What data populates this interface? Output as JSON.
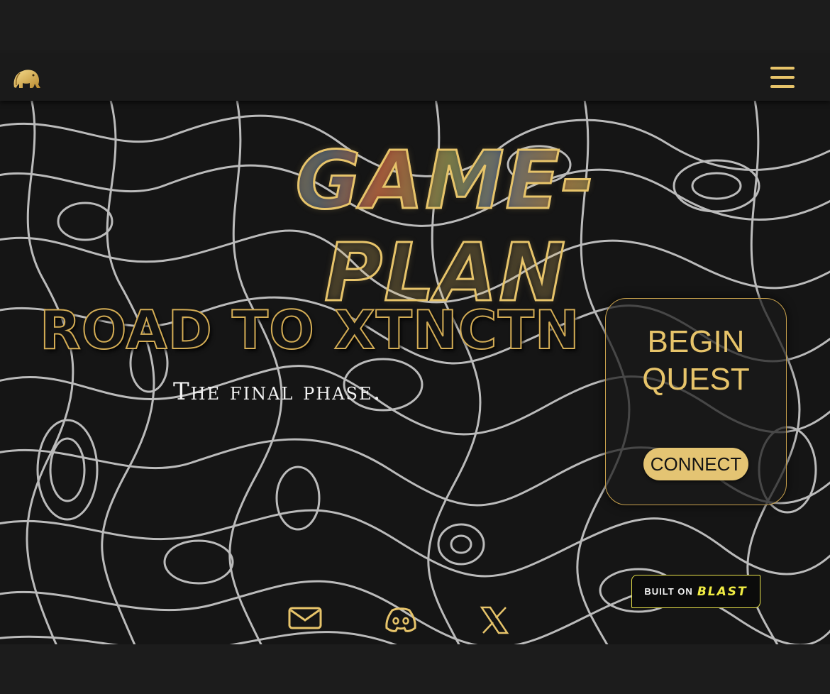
{
  "nav": {
    "logo": "elephant-logo-icon",
    "menu_icon": "hamburger-menu-icon"
  },
  "hero": {
    "game_title": "GAME-PLAN",
    "road_title": "ROAD TO XTNCTN",
    "subtitle": "The final phase."
  },
  "quest_card": {
    "title_line1": "BEGIN",
    "title_line2": "QUEST",
    "connect_label": "CONNECT"
  },
  "badge": {
    "built_on": "BUILT ON",
    "brand": "BLAST"
  },
  "social": {
    "icons": [
      "mail-icon",
      "discord-icon",
      "x-twitter-icon"
    ]
  },
  "colors": {
    "accent_gold": "#e7c46a",
    "background": "#151515",
    "blast_yellow": "#f0ec43"
  }
}
